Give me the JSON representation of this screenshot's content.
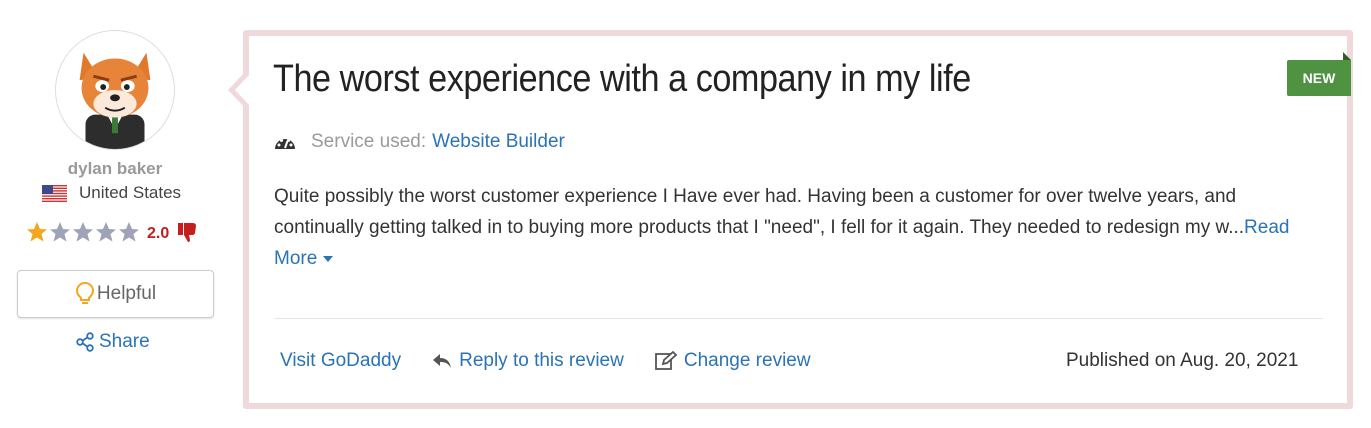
{
  "reviewer": {
    "name": "dylan baker",
    "country": "United States",
    "flag_icon": "us-flag-icon",
    "rating": "2.0",
    "rating_stars": 1,
    "rating_max": 5,
    "avatar_icon": "fox-avatar-icon"
  },
  "actions": {
    "helpful_label": "Helpful",
    "share_label": "Share"
  },
  "review": {
    "title": "The worst experience with a company in my life",
    "badge": "NEW",
    "service_label": "Service used:",
    "service_value": "Website Builder",
    "body": "Quite possibly the worst customer experience I Have ever had. Having been a customer for over twelve years, and continually getting talked in to buying more products that I \"need\", I fell for it again. They needed to redesign my w...",
    "read_more": "Read More"
  },
  "footer": {
    "visit_label": "Visit GoDaddy",
    "reply_label": "Reply to this review",
    "change_label": "Change review",
    "published": "Published on Aug. 20, 2021"
  },
  "colors": {
    "link": "#2a73b6",
    "badge": "#4e9242",
    "card_border": "#f0d9da",
    "star_filled": "#f2a71e",
    "star_empty": "#9ea3b8",
    "rating": "#c41e1e"
  }
}
